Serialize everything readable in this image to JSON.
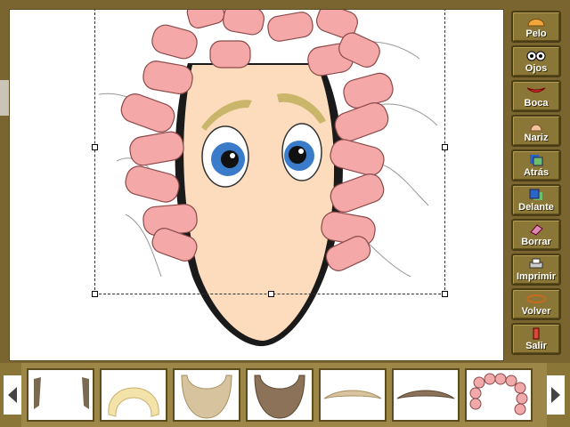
{
  "sidebar": {
    "buttons": [
      {
        "label": "Pelo",
        "icon": "hair-icon"
      },
      {
        "label": "Ojos",
        "icon": "eyes-icon"
      },
      {
        "label": "Boca",
        "icon": "mouth-icon"
      },
      {
        "label": "Nariz",
        "icon": "nose-icon"
      },
      {
        "label": "Atrás",
        "icon": "send-back-icon"
      },
      {
        "label": "Delante",
        "icon": "bring-front-icon"
      },
      {
        "label": "Borrar",
        "icon": "eraser-icon"
      },
      {
        "label": "Imprimir",
        "icon": "printer-icon"
      },
      {
        "label": "Volver",
        "icon": "back-icon"
      },
      {
        "label": "Salir",
        "icon": "exit-icon"
      }
    ]
  },
  "thumbnails": [
    {
      "name": "sideburns",
      "color": "#7b6a52"
    },
    {
      "name": "blonde-hair",
      "color": "#f3e3a8"
    },
    {
      "name": "light-beard",
      "color": "#d7c39e"
    },
    {
      "name": "brown-beard",
      "color": "#8b7258"
    },
    {
      "name": "light-mustache",
      "color": "#d9c4a0"
    },
    {
      "name": "brown-mustache",
      "color": "#8b7258"
    },
    {
      "name": "pink-curlers",
      "color": "#f2a9a9"
    }
  ],
  "colors": {
    "frame": "#7a6530",
    "button": "#8a7636",
    "skin": "#fcdcbc",
    "curler": "#f5a8a8"
  }
}
